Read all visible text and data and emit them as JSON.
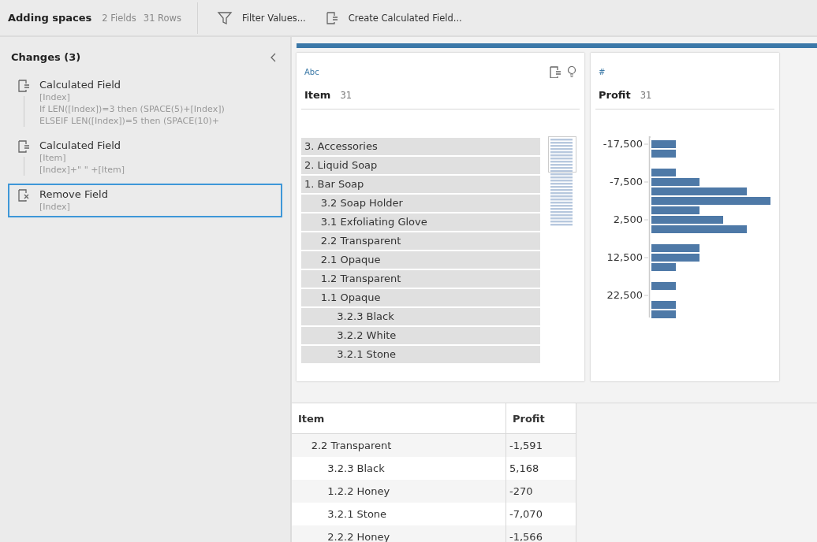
{
  "toolbar": {
    "title": "Adding spaces",
    "fields": "2 Fields",
    "rows": "31 Rows",
    "actions": [
      {
        "label": "Filter Values...",
        "kind": "filter"
      },
      {
        "label": "Create Calculated Field...",
        "kind": "calc"
      }
    ]
  },
  "changes": {
    "title": "Changes (3)",
    "items": [
      {
        "title": "Calculated Field",
        "kind": "calc",
        "selected": false,
        "lines": [
          "[Index]",
          "If LEN([Index])=3 then (SPACE(5)+[Index])",
          "ELSEIF LEN([Index])=5 then (SPACE(10)+"
        ]
      },
      {
        "title": "Calculated Field",
        "kind": "calc",
        "selected": false,
        "lines": [
          "[Item]",
          "[Index]+\" \" +[Item]"
        ]
      },
      {
        "title": "Remove Field",
        "kind": "remove",
        "selected": true,
        "lines": [
          "[Index]"
        ]
      }
    ]
  },
  "profile_cards": [
    {
      "kind": "text",
      "type_label": "Abc",
      "name": "Item",
      "count": "31",
      "values": [
        "3. Accessories",
        "2. Liquid Soap",
        "1. Bar Soap",
        "     3.2 Soap Holder",
        "     3.1 Exfoliating Glove",
        "     2.2 Transparent",
        "     2.1 Opaque",
        "     1.2 Transparent",
        "     1.1 Opaque",
        "          3.2.3 Black",
        "          3.2.2 White",
        "          3.2.1 Stone"
      ]
    },
    {
      "kind": "number",
      "type_label": "#",
      "name": "Profit",
      "count": "31",
      "axis_labels": [
        "-17,500",
        "-7,500",
        "2,500",
        "12,500",
        "22,500"
      ]
    }
  ],
  "table": {
    "columns": [
      "Item",
      "Profit"
    ],
    "rows": [
      [
        "     2.2 Transparent",
        "-1,591"
      ],
      [
        "          3.2.3 Black",
        "5,168"
      ],
      [
        "          1.2.2 Honey",
        "-270"
      ],
      [
        "          3.2.1 Stone",
        "-7,070"
      ],
      [
        "          2.2.2 Honey",
        "-1,566"
      ]
    ]
  }
}
